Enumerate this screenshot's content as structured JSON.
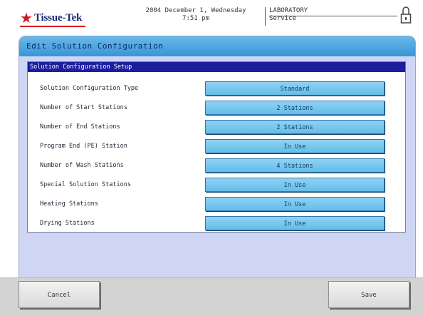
{
  "header": {
    "logo_mark": "★",
    "logo_text": "Tissue-Tek",
    "date": "2004 December 1, Wednesday",
    "time": "7:51 pm",
    "user_level": "LABORATORY",
    "mode": "Service"
  },
  "window": {
    "title": "Edit Solution Configuration",
    "panel_title": "Solution Configuration Setup",
    "rows": [
      {
        "label": "Solution Configuration Type",
        "value": "Standard"
      },
      {
        "label": "Number of Start Stations",
        "value": "2 Stations"
      },
      {
        "label": "Number of End Stations",
        "value": "2 Stations"
      },
      {
        "label": "Program End (PE) Station",
        "value": "In Use"
      },
      {
        "label": "Number of Wash Stations",
        "value": "4 Stations"
      },
      {
        "label": "Special Solution Stations",
        "value": "In Use"
      },
      {
        "label": "Heating Stations",
        "value": "In Use"
      },
      {
        "label": "Drying Stations",
        "value": "In Use"
      }
    ]
  },
  "footer": {
    "cancel_label": "Cancel",
    "save_label": "Save"
  },
  "colors": {
    "titlebar": "#3a95d6",
    "panel_title": "#1d1e9e",
    "option_button": "#64bde9",
    "window_bg": "#cfd6f3",
    "logo_red": "#d8141c"
  }
}
